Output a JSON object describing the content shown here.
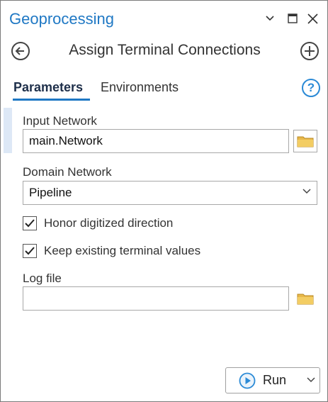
{
  "pane": {
    "title": "Geoprocessing"
  },
  "tool": {
    "title": "Assign Terminal Connections"
  },
  "tabs": [
    {
      "label": "Parameters",
      "active": true
    },
    {
      "label": "Environments",
      "active": false
    }
  ],
  "help": {
    "glyph": "?"
  },
  "params": {
    "input_network": {
      "label": "Input Network",
      "value": "main.Network"
    },
    "domain_network": {
      "label": "Domain Network",
      "value": "Pipeline"
    },
    "honor_direction": {
      "label": "Honor digitized direction",
      "checked": true
    },
    "keep_terminal": {
      "label": "Keep existing terminal values",
      "checked": true
    },
    "log_file": {
      "label": "Log file",
      "value": ""
    }
  },
  "run": {
    "label": "Run"
  },
  "colors": {
    "accent": "#1f78c4",
    "folder": "#e8b84a",
    "run_icon": "#2b8ad6"
  },
  "icons": [
    "back-arrow-icon",
    "add-circle-icon",
    "folder-icon",
    "chevron-down-icon",
    "checkmark-icon",
    "play-circle-icon",
    "help-icon",
    "pin-icon",
    "maximize-icon",
    "close-icon"
  ]
}
